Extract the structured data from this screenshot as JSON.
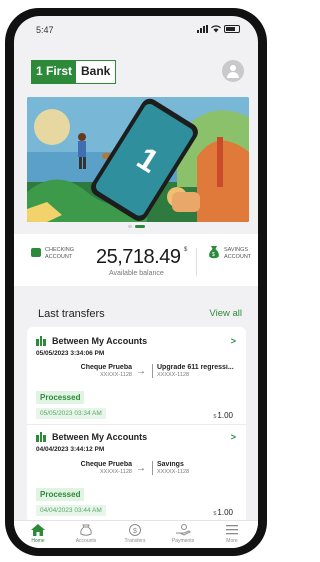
{
  "status_bar": {
    "time": "5:47"
  },
  "brand": {
    "logo_part1": "1 First",
    "logo_part2": "Bank"
  },
  "balance": {
    "checking_label_line1": "CHECKING",
    "checking_label_line2": "ACCOUNT",
    "amount": "25,718.49",
    "currency": "$",
    "available_label": "Available balance",
    "savings_label_line1": "SAVINGS",
    "savings_label_line2": "ACCOUNT"
  },
  "carousel": {
    "active_index": 1,
    "count": 2
  },
  "transfers": {
    "title": "Last transfers",
    "view_all": "View all",
    "items": [
      {
        "title": "Between My Accounts",
        "datetime": "05/05/2023 3:34:06 PM",
        "from_name": "Cheque Prueba",
        "from_account": "XXXXX-1128",
        "to_name": "Upgrade 611 regressi...",
        "to_account": "XXXXX-1128",
        "status": "Processed",
        "processed_date": "05/05/2023 03:34 AM",
        "currency": "$",
        "amount": "1.00"
      },
      {
        "title": "Between My Accounts",
        "datetime": "04/04/2023 3:44:12 PM",
        "from_name": "Cheque Prueba",
        "from_account": "XXXXX-1128",
        "to_name": "Savings",
        "to_account": "XXXXX-1128",
        "status": "Processed",
        "processed_date": "04/04/2023 03:44 AM",
        "currency": "$",
        "amount": "1.00"
      }
    ]
  },
  "nav": {
    "items": [
      {
        "label": "Home",
        "icon": "home-icon",
        "active": true
      },
      {
        "label": "Accounts",
        "icon": "accounts-icon",
        "active": false
      },
      {
        "label": "Transfers",
        "icon": "transfers-icon",
        "active": false
      },
      {
        "label": "Payments",
        "icon": "payments-icon",
        "active": false
      },
      {
        "label": "More",
        "icon": "menu-icon",
        "active": false
      }
    ]
  },
  "colors": {
    "brand_green": "#2d8a3a",
    "processed_bg": "#e1f3e3",
    "screen_bg": "#f1f1f3"
  }
}
